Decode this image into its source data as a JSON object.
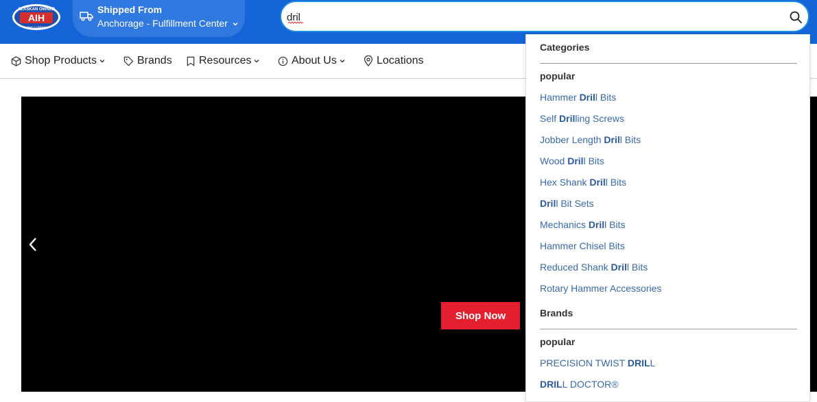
{
  "header": {
    "logo_text": "ALASKAN OWNED AIH A BMC COMPANY",
    "ship_from_label": "Shipped From",
    "ship_from_location": "Anchorage - Fulfillment Center",
    "search_value": "dril"
  },
  "nav": {
    "items": [
      {
        "label": "Shop Products",
        "icon": "box-icon",
        "dropdown": true
      },
      {
        "label": "Brands",
        "icon": "tag-icon",
        "dropdown": false
      },
      {
        "label": "Resources",
        "icon": "bookmark-icon",
        "dropdown": true
      },
      {
        "label": "About Us",
        "icon": "info-icon",
        "dropdown": true
      },
      {
        "label": "Locations",
        "icon": "map-pin-icon",
        "dropdown": false
      }
    ]
  },
  "hero": {
    "cta_label": "Shop Now"
  },
  "suggestions": {
    "query": "dril",
    "categories_heading": "Categories",
    "categories_sub": "popular",
    "categories": [
      {
        "pre": "Hammer ",
        "match": "Dril",
        "post": "l Bits"
      },
      {
        "pre": "Self ",
        "match": "Dril",
        "post": "ling Screws"
      },
      {
        "pre": "Jobber Length ",
        "match": "Dril",
        "post": "l Bits"
      },
      {
        "pre": "Wood ",
        "match": "Dril",
        "post": "l Bits"
      },
      {
        "pre": "Hex Shank ",
        "match": "Dril",
        "post": "l Bits"
      },
      {
        "pre": "",
        "match": "Dril",
        "post": "l Bit Sets"
      },
      {
        "pre": "Mechanics ",
        "match": "Dril",
        "post": "l Bits"
      },
      {
        "pre": "Hammer Chisel Bits",
        "match": "",
        "post": ""
      },
      {
        "pre": "Reduced Shank ",
        "match": "Dril",
        "post": "l Bits"
      },
      {
        "pre": "Rotary Hammer Accessories",
        "match": "",
        "post": ""
      }
    ],
    "brands_heading": "Brands",
    "brands_sub": "popular",
    "brands": [
      {
        "pre": "PRECISION TWIST ",
        "match": "DRIL",
        "post": "L"
      },
      {
        "pre": "",
        "match": "DRIL",
        "post": "L DOCTOR®"
      }
    ]
  },
  "colors": {
    "header_bg": "#1565d8",
    "link": "#3869a8",
    "cta": "#e5202e"
  }
}
